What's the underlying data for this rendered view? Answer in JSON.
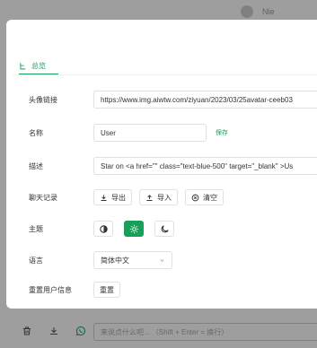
{
  "background": {
    "user_name": "Nie"
  },
  "tabs": [
    {
      "label": "总览",
      "active": true
    }
  ],
  "settings": {
    "avatar": {
      "label": "头像链接",
      "value": "https://www.img.aiwtw.com/ziyuan/2023/03/25avatar-ceeb03"
    },
    "name": {
      "label": "名称",
      "value": "User",
      "save_label": "保存"
    },
    "description": {
      "label": "描述",
      "value": "Star on <a href=\"\" class=\"text-blue-500\" target=\"_blank\" >Us"
    },
    "chat_history": {
      "label": "聊天记录",
      "export_label": "导出",
      "import_label": "导入",
      "clear_label": "清空"
    },
    "theme": {
      "label": "主题",
      "options": [
        "auto",
        "light",
        "dark"
      ],
      "selected": "light"
    },
    "language": {
      "label": "语言",
      "value": "简体中文"
    },
    "reset_user": {
      "label": "重置用户信息",
      "button_label": "重置"
    }
  },
  "footer": {
    "input_placeholder": "来说点什么吧... （Shift + Enter = 换行）"
  },
  "colors": {
    "accent": "#18a058"
  }
}
